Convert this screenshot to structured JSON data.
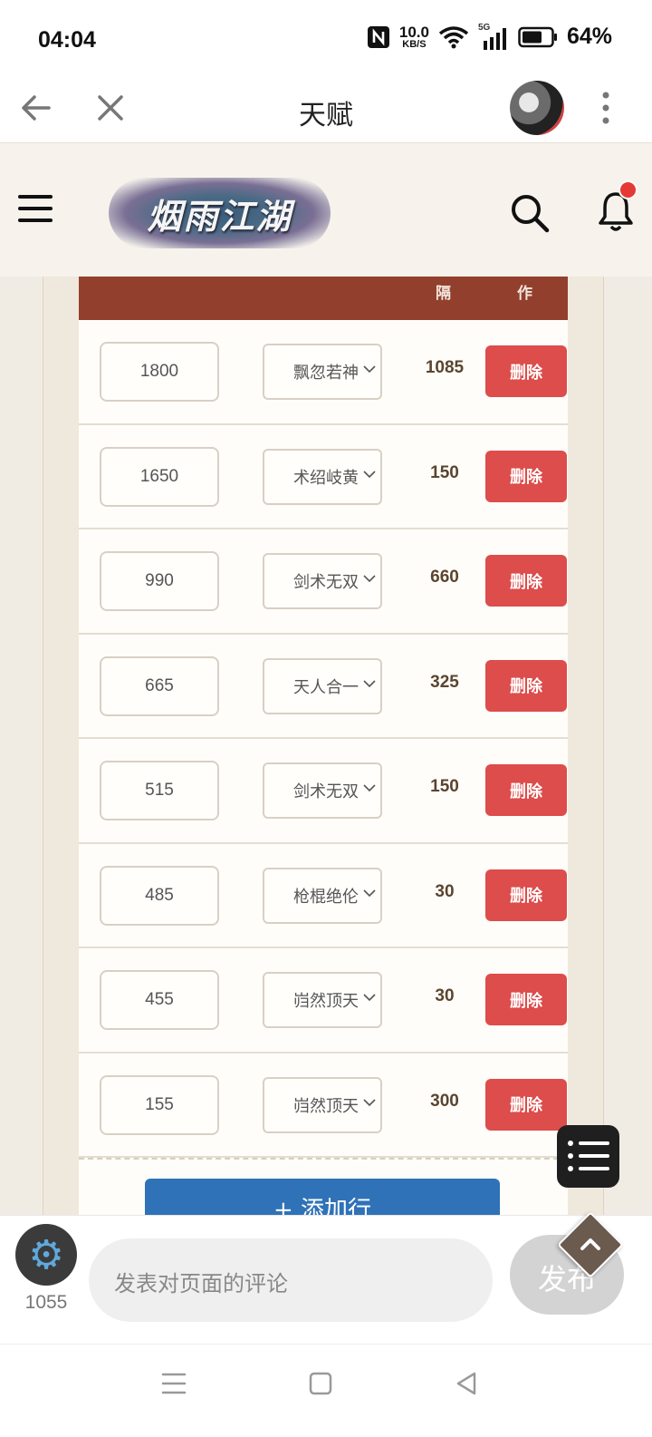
{
  "status_bar": {
    "time": "04:04",
    "net_speed_value": "10.0",
    "net_speed_unit": "KB/S",
    "network": "5G",
    "battery": "64%"
  },
  "app_bar": {
    "title": "天赋"
  },
  "site": {
    "logo_text": "烟雨江湖"
  },
  "table": {
    "headers": {
      "interval_partial": "隔",
      "action_partial": "作"
    },
    "rows": [
      {
        "value": "1800",
        "talent": "飘忽若神",
        "interval": "1085",
        "delete_label": "删除"
      },
      {
        "value": "1650",
        "talent": "术绍岐黄",
        "interval": "150",
        "delete_label": "删除"
      },
      {
        "value": "990",
        "talent": "剑术无双",
        "interval": "660",
        "delete_label": "删除"
      },
      {
        "value": "665",
        "talent": "天人合一",
        "interval": "325",
        "delete_label": "删除"
      },
      {
        "value": "515",
        "talent": "剑术无双",
        "interval": "150",
        "delete_label": "删除"
      },
      {
        "value": "485",
        "talent": "枪棍绝伦",
        "interval": "30",
        "delete_label": "删除"
      },
      {
        "value": "455",
        "talent": "岿然顶天",
        "interval": "30",
        "delete_label": "删除"
      },
      {
        "value": "155",
        "talent": "岿然顶天",
        "interval": "300",
        "delete_label": "删除"
      }
    ],
    "add_row_label": "+ 添加行"
  },
  "comment_bar": {
    "count": "1055",
    "placeholder": "发表对页面的评论",
    "publish_label": "发布"
  },
  "colors": {
    "header_bar": "#92402d",
    "delete_button": "#dc4d4b",
    "add_button": "#2f72b8"
  }
}
